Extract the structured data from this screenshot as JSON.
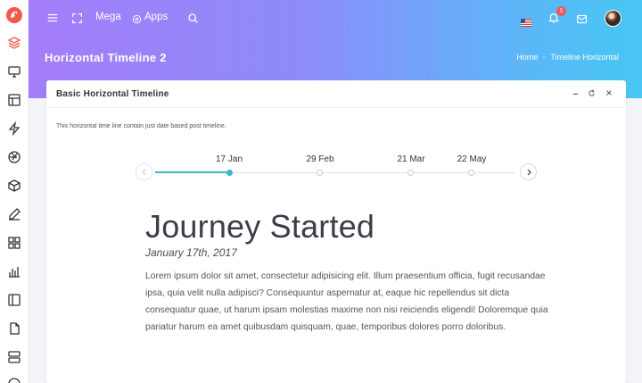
{
  "topbar": {
    "mega_label": "Mega",
    "apps_label": "Apps",
    "notification_count": "5"
  },
  "page": {
    "title": "Horizontal Timeline 2",
    "breadcrumb": [
      "Home",
      "-",
      "Timeline Horizontal"
    ]
  },
  "card": {
    "title": "Basic Horizontal Timeline",
    "description": "This horizontal time line contain just date based post timeline."
  },
  "timeline": {
    "dates": [
      "17 Jan",
      "29 Feb",
      "21 Mar",
      "22 May"
    ],
    "selected_index": 0
  },
  "event": {
    "title": "Journey Started",
    "date": "January 17th, 2017",
    "body": "Lorem ipsum dolor sit amet, consectetur adipisicing elit. Illum praesentium officia, fugit recusandae ipsa, quia velit nulla adipisci? Consequuntur aspernatur at, eaque hic repellendus sit dicta consequatur quae, ut harum ipsam molestias maxime non nisi reiciendis eligendi! Doloremque quia pariatur harum ea amet quibusdam quisquam, quae, temporibus dolores porro doloribus."
  },
  "colors": {
    "header_gradient_start": "#a47dfb",
    "header_gradient_end": "#47c7f4",
    "accent": "#3ab7c8",
    "logo": "#f15a4a",
    "badge": "#f15a5a"
  },
  "icons": {
    "sidebar": [
      "layers-icon",
      "monitor-icon",
      "layout-icon",
      "zap-icon",
      "aperture-icon",
      "box-icon",
      "edit-icon",
      "grid-icon",
      "bar-chart-icon",
      "sidebar-icon",
      "file-icon",
      "server-icon"
    ],
    "topbar": [
      "menu-icon",
      "fullscreen-icon",
      "apps-icon",
      "search-icon",
      "flag-icon",
      "bell-icon",
      "mail-icon"
    ],
    "card": [
      "minimize-icon",
      "refresh-icon",
      "close-icon"
    ],
    "timeline": [
      "chevron-left-icon",
      "chevron-right-icon"
    ]
  }
}
